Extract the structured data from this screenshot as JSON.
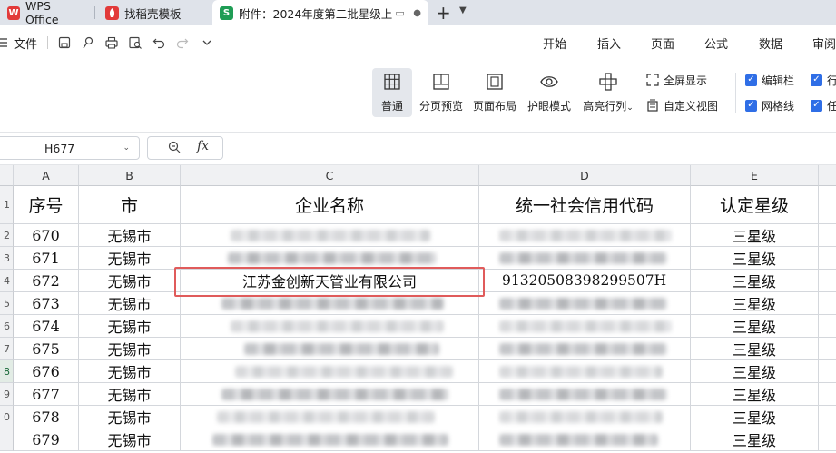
{
  "tabs": [
    {
      "label": "WPS Office",
      "logo": "W",
      "logo_color": "#e23a3a"
    },
    {
      "label": "找稻壳模板",
      "logo": "▮",
      "logo_color": "#e23a3a"
    },
    {
      "label": "附件：2024年度第二批星级上",
      "logo": "S",
      "logo_color": "#1f9d55",
      "active": true
    }
  ],
  "menu": {
    "file_label": "文件",
    "ribbon_tabs": [
      "开始",
      "插入",
      "页面",
      "公式",
      "数据",
      "审阅"
    ]
  },
  "ribbon": {
    "buttons": [
      "普通",
      "分页预览",
      "页面布局",
      "护眼模式",
      "高亮行列"
    ],
    "fullscreen_label": "全屏显示",
    "custom_view_label": "自定义视图",
    "checkboxes": [
      "编辑栏",
      "行",
      "网格线",
      "任"
    ]
  },
  "formula_bar": {
    "cell_ref": "H677",
    "fx": "fx",
    "value": ""
  },
  "sheet": {
    "columns": [
      "A",
      "B",
      "C",
      "D",
      "E"
    ],
    "row_numbers": [
      "1",
      "2",
      "3",
      "4",
      "5",
      "6",
      "7",
      "8",
      "9",
      "0"
    ],
    "header": {
      "seq": "序号",
      "city": "市",
      "company": "企业名称",
      "credit_code": "统一社会信用代码",
      "level": "认定星级"
    },
    "rows": [
      {
        "seq": "670",
        "city": "无锡市",
        "company": "",
        "credit_code": "",
        "level": "三星级"
      },
      {
        "seq": "671",
        "city": "无锡市",
        "company": "",
        "credit_code": "",
        "level": "三星级"
      },
      {
        "seq": "672",
        "city": "无锡市",
        "company": "江苏金创新天管业有限公司",
        "credit_code": "91320508398299507H",
        "level": "三星级"
      },
      {
        "seq": "673",
        "city": "无锡市",
        "company": "",
        "credit_code": "",
        "level": "三星级"
      },
      {
        "seq": "674",
        "city": "无锡市",
        "company": "",
        "credit_code": "",
        "level": "三星级"
      },
      {
        "seq": "675",
        "city": "无锡市",
        "company": "",
        "credit_code": "",
        "level": "三星级"
      },
      {
        "seq": "676",
        "city": "无锡市",
        "company": "",
        "credit_code": "",
        "level": "三星级"
      },
      {
        "seq": "677",
        "city": "无锡市",
        "company": "",
        "credit_code": "",
        "level": "三星级"
      },
      {
        "seq": "678",
        "city": "无锡市",
        "company": "",
        "credit_code": "",
        "level": "三星级"
      },
      {
        "seq": "679",
        "city": "无锡市",
        "company": "",
        "credit_code": "",
        "level": "三星级"
      }
    ]
  },
  "colors": {
    "highlight": "#e05b5b",
    "accent": "#2f6ee6"
  }
}
